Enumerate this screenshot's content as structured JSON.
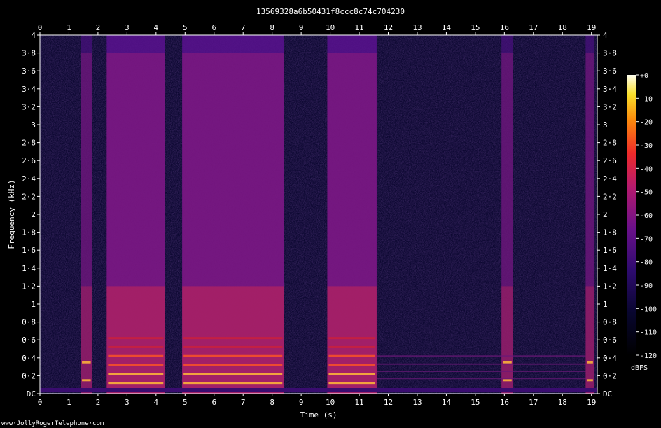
{
  "chart_data": {
    "type": "heatmap",
    "title": "13569328a6b50431f8ccc8c74c704230",
    "xlabel": "Time (s)",
    "ylabel": "Frequency (kHz)",
    "xlim": [
      0,
      19.2
    ],
    "ylim": [
      0,
      4
    ],
    "x_ticks": [
      "0",
      "1",
      "2",
      "3",
      "4",
      "5",
      "6",
      "7",
      "8",
      "9",
      "10",
      "11",
      "12",
      "13",
      "14",
      "15",
      "16",
      "17",
      "18",
      "19"
    ],
    "y_ticks": [
      "DC",
      "0·2",
      "0·4",
      "0·6",
      "0·8",
      "1",
      "1·2",
      "1·4",
      "1·6",
      "1·8",
      "2",
      "2·2",
      "2·4",
      "2·6",
      "2·8",
      "3",
      "3·2",
      "3·4",
      "3·6",
      "3·8",
      "4"
    ],
    "colorbar": {
      "label": "dBFS",
      "ticks": [
        "+0",
        "-10",
        "-20",
        "-30",
        "-40",
        "-50",
        "-60",
        "-70",
        "-80",
        "-90",
        "-100",
        "-110",
        "-120"
      ],
      "range": [
        -120,
        0
      ]
    },
    "speech_segments_s": [
      [
        1.4,
        1.8
      ],
      [
        2.3,
        4.3
      ],
      [
        4.9,
        8.4
      ],
      [
        9.9,
        11.6
      ],
      [
        15.9,
        16.3
      ],
      [
        18.8,
        19.1
      ]
    ],
    "footer": "www·JollyRogerTelephone·com"
  }
}
